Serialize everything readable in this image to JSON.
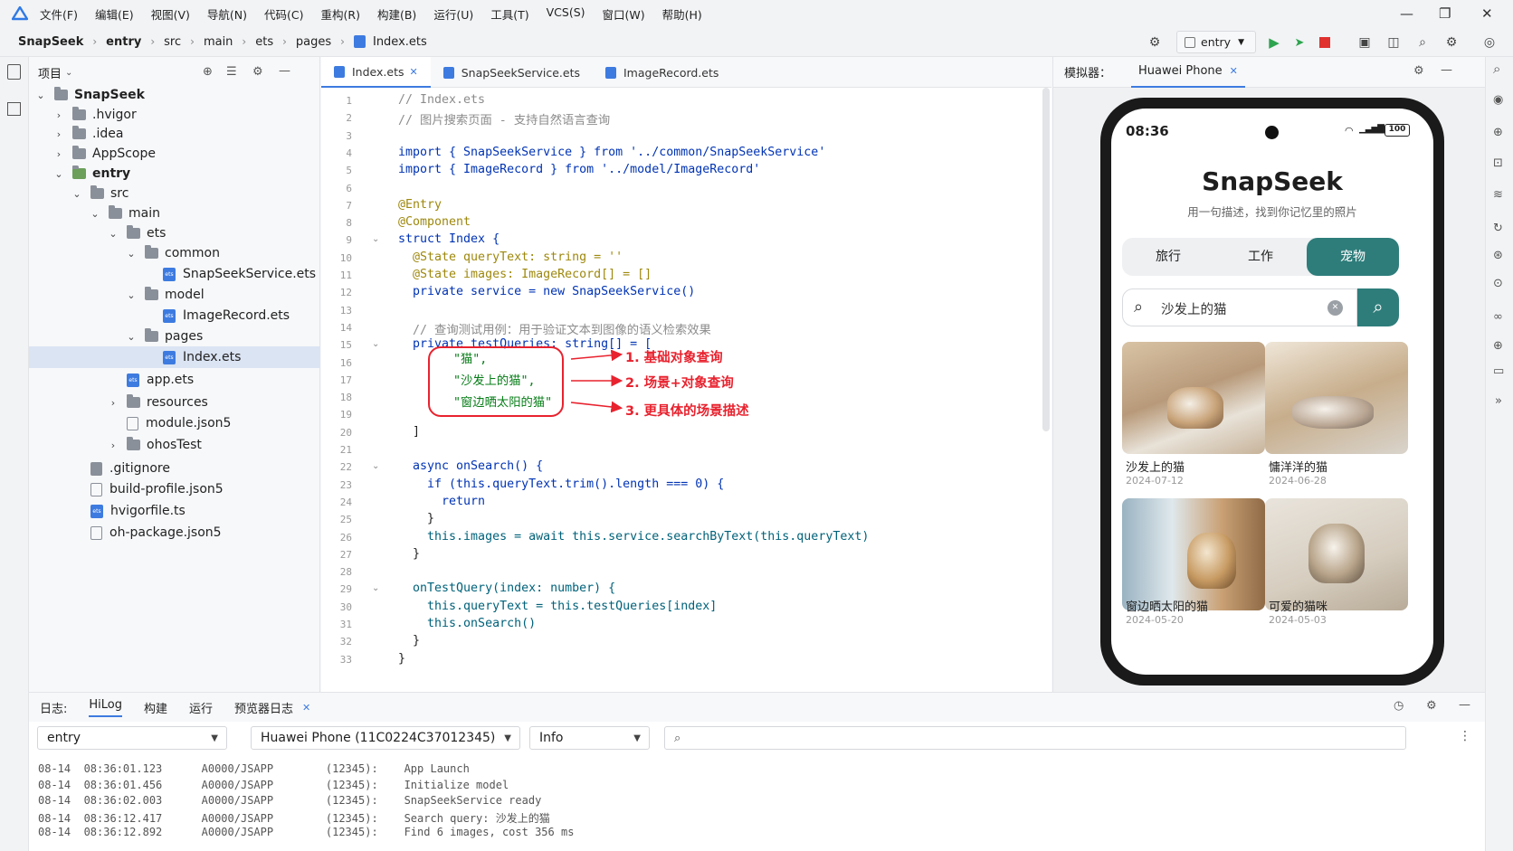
{
  "menu": {
    "items": [
      "文件(F)",
      "编辑(E)",
      "视图(V)",
      "导航(N)",
      "代码(C)",
      "重构(R)",
      "构建(B)",
      "运行(U)",
      "工具(T)",
      "VCS(S)",
      "窗口(W)",
      "帮助(H)"
    ]
  },
  "nav": {
    "breadcrumbs": [
      "SnapSeek",
      "entry",
      "src",
      "main",
      "ets",
      "pages",
      "Index.ets"
    ],
    "run_config": "entry"
  },
  "project": {
    "title": "项目",
    "tree": [
      {
        "label": "SnapSeek",
        "kind": "folder-root",
        "depth": 0,
        "chev": "v",
        "bold": true
      },
      {
        "label": ".hvigor",
        "kind": "folder",
        "depth": 1,
        "chev": ">"
      },
      {
        "label": ".idea",
        "kind": "folder",
        "depth": 1,
        "chev": ">"
      },
      {
        "label": "AppScope",
        "kind": "folder",
        "depth": 1,
        "chev": ">"
      },
      {
        "label": "entry",
        "kind": "folder-mod",
        "depth": 1,
        "chev": "v",
        "bold": true
      },
      {
        "label": "src",
        "kind": "folder",
        "depth": 2,
        "chev": "v"
      },
      {
        "label": "main",
        "kind": "folder",
        "depth": 3,
        "chev": "v"
      },
      {
        "label": "ets",
        "kind": "folder",
        "depth": 4,
        "chev": "v"
      },
      {
        "label": "common",
        "kind": "folder",
        "depth": 5,
        "chev": "v"
      },
      {
        "label": "SnapSeekService.ets",
        "kind": "ets",
        "depth": 6,
        "chev": ""
      },
      {
        "label": "model",
        "kind": "folder",
        "depth": 5,
        "chev": "v"
      },
      {
        "label": "ImageRecord.ets",
        "kind": "ets",
        "depth": 6,
        "chev": ""
      },
      {
        "label": "pages",
        "kind": "folder",
        "depth": 5,
        "chev": "v"
      },
      {
        "label": "Index.ets",
        "kind": "ets",
        "depth": 6,
        "chev": "",
        "selected": true
      },
      {
        "label": "app.ets",
        "kind": "ets",
        "depth": 4,
        "chev": ""
      },
      {
        "label": "resources",
        "kind": "folder",
        "depth": 4,
        "chev": ">"
      },
      {
        "label": "module.json5",
        "kind": "json",
        "depth": 4,
        "chev": ""
      },
      {
        "label": "ohosTest",
        "kind": "folder",
        "depth": 4,
        "chev": ">"
      },
      {
        "label": ".gitignore",
        "kind": "git",
        "depth": 2,
        "chev": ""
      },
      {
        "label": "build-profile.json5",
        "kind": "json",
        "depth": 2,
        "chev": ""
      },
      {
        "label": "hvigorfile.ts",
        "kind": "ets",
        "depth": 2,
        "chev": ""
      },
      {
        "label": "oh-package.json5",
        "kind": "json",
        "depth": 2,
        "chev": ""
      }
    ]
  },
  "editor": {
    "tabs": [
      "Index.ets",
      "SnapSeekService.ets",
      "ImageRecord.ets"
    ],
    "lines": [
      "// Index.ets",
      "// 图片搜索页面 - 支持自然语言查询",
      "",
      "import { SnapSeekService } from '../common/SnapSeekService'",
      "import { ImageRecord } from '../model/ImageRecord'",
      "",
      "@Entry",
      "@Component",
      "struct Index {",
      "  @State queryText: string = ''",
      "  @State images: ImageRecord[] = []",
      "  private service = new SnapSeekService()",
      "",
      "  // 查询测试用例：用于验证文本到图像的语义检索效果",
      "  private testQueries: string[] = [",
      "",
      "",
      "",
      "",
      "  ]",
      "",
      "  async onSearch() {",
      "    if (this.queryText.trim().length === 0) {",
      "      return",
      "    }",
      "    this.images = await this.service.searchByText(this.queryText)",
      "  }",
      "",
      "  onTestQuery(index: number) {",
      "    this.queryText = this.testQueries[index]",
      "    this.onSearch()",
      "  }",
      "}"
    ],
    "queries": [
      "\"猫\",",
      "\"沙发上的猫\",",
      "\"窗边晒太阳的猫\""
    ],
    "annotations": [
      "1. 基础对象查询",
      "2. 场景+对象查询",
      "3. 更具体的场景描述"
    ]
  },
  "simulator": {
    "label": "模拟器：",
    "device_tab": "Huawei Phone",
    "phone": {
      "time": "08:36",
      "battery": "100",
      "app_title": "SnapSeek",
      "app_subtitle": "用一句描述，找到你记忆里的照片",
      "tabs": [
        "旅行",
        "工作",
        "宠物"
      ],
      "active_tab": "宠物",
      "search_value": "沙发上的猫",
      "results": [
        {
          "title": "沙发上的猫",
          "date": "2024-07-12"
        },
        {
          "title": "慵洋洋的猫",
          "date": "2024-06-28"
        },
        {
          "title": "窗边晒太阳的猫",
          "date": "2024-05-20"
        },
        {
          "title": "可爱的猫咪",
          "date": "2024-05-03"
        }
      ]
    }
  },
  "log": {
    "label": "日志:",
    "tabs": [
      "HiLog",
      "构建",
      "运行",
      "预览器日志"
    ],
    "module_select": "entry",
    "device_select": "Huawei Phone (11C0224C37012345)",
    "level_select": "Info",
    "lines": [
      "08-14  08:36:01.123      A0000/JSAPP        (12345):    App Launch",
      "08-14  08:36:01.456      A0000/JSAPP        (12345):    Initialize model",
      "08-14  08:36:02.003      A0000/JSAPP        (12345):    SnapSeekService ready",
      "08-14  08:36:12.417      A0000/JSAPP        (12345):    Search query: 沙发上的猫",
      "08-14  08:36:12.892      A0000/JSAPP        (12345):    Find 6 images, cost 356 ms"
    ]
  },
  "colors": {
    "accent": "#3d7be0",
    "teal": "#2e7d7b",
    "annotation": "#e8222e"
  }
}
